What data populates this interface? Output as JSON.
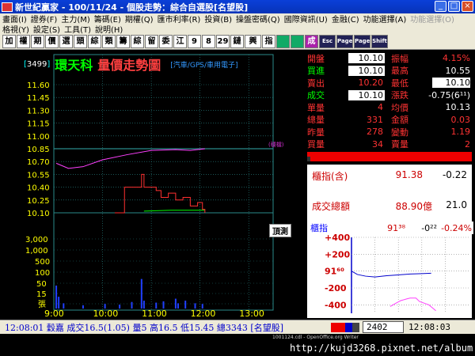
{
  "window": {
    "title": "新世紀贏家 - 100/11/24 - 個股走勢：綜合自選股[名望股]",
    "min": "_",
    "max": "□",
    "close": "×"
  },
  "menu": {
    "row1": [
      "畫面(I)",
      "證券(F)",
      "主力(M)",
      "籌碼(E)",
      "期權(Q)",
      "匯市利率(R)",
      "投資(B)",
      "操盤密碼(Q)",
      "國際資訊(U)",
      "金融(C)",
      "功能選擇(A)",
      "功能選擇(O)"
    ],
    "row2": [
      "格視(Y)",
      "設定(S)",
      "工具(T)",
      "說明(H)"
    ]
  },
  "toolbar": [
    "加",
    "權",
    "期",
    "價",
    "選",
    "頭",
    "綜",
    "類",
    "籌",
    "綜",
    "留",
    "委",
    "江",
    "9",
    "8",
    "29",
    "鏈",
    "興",
    "指",
    "",
    "",
    "成",
    "Esc",
    "Page",
    "Page",
    "Shift"
  ],
  "stock": {
    "code": "3499",
    "name": "環天科",
    "chart_title": "量價走勢圖",
    "category": "[汽車/GPS/車用電子]"
  },
  "chart_labels": {
    "day_high": "(穩檔)",
    "badge": "頂測"
  },
  "quote": {
    "rows": [
      {
        "l1": "開盤",
        "v1": "10.10",
        "b1": true,
        "l2": "振幅",
        "v2": "4.15%",
        "c2": "red"
      },
      {
        "l1": "買進",
        "v1": "10.10",
        "b1": true,
        "l2": "最高",
        "v2": "10.55",
        "c2": "white"
      },
      {
        "l1": "賣出",
        "v1": "10.20",
        "b1": false,
        "l2": "最低",
        "v2": "10.10",
        "b2": true
      },
      {
        "l1": "成交",
        "v1": "10.10",
        "b1": true,
        "l2": "漲跌",
        "v2": "-0.75(6¹¹)",
        "c2": "white"
      },
      {
        "l1": "單量",
        "v1": "4",
        "b1": false,
        "l2": "均價",
        "v2": "10.13",
        "c2": "white"
      },
      {
        "l1": "總量",
        "v1": "331",
        "b1": false,
        "l2": "金額",
        "v2": "0.03",
        "c2": "red"
      },
      {
        "l1": "昨量",
        "v1": "278",
        "b1": false,
        "l2": "變動",
        "v2": "1.19",
        "c2": "red"
      },
      {
        "l1": "買量",
        "v1": "34",
        "b1": false,
        "l2": "賣量",
        "v2": "2",
        "c2": "red"
      }
    ]
  },
  "index_panel": {
    "label1": "櫃指(含)",
    "val1": "91.38",
    "chg1": "-0.22",
    "label2": "成交總額",
    "val2": "88.90億",
    "chg2": "21.0"
  },
  "mini": {
    "label": "櫃指",
    "val": "91³⁸",
    "chg": "-0²²",
    "pct": "-0.24%",
    "y_labels": [
      "+400",
      "+200",
      "91⁶⁰",
      "-200",
      "-400"
    ]
  },
  "status": {
    "text": "12:08:01 穀嘉 成交16.5(1.05) 量5 高16.5 低15.45 總3343 [名望股]",
    "code": "2402",
    "time": "12:08:03"
  },
  "footer": {
    "small": "1001124.cdl - OpenOffice.org Writer",
    "url": "http://kujd3268.pixnet.net/album"
  },
  "colors": {
    "price_line": "#ff3030",
    "avg_line": "#ff40ff",
    "ref_line": "#00ff00",
    "volume": "#2040ff",
    "grid": "#2a8a8a"
  },
  "chart_data": {
    "type": "line",
    "price_axis": [
      "11.60",
      "11.45",
      "11.30",
      "11.15",
      "11.00",
      "10.85",
      "10.70",
      "10.55",
      "10.40",
      "10.25",
      "10.10"
    ],
    "volume_axis": [
      "3,000",
      "1,000",
      "500",
      "100",
      "50",
      "15",
      "張"
    ],
    "time_axis": [
      "9:00",
      "10:00",
      "11:00",
      "12:00",
      "13:00"
    ],
    "ylim": [
      10.1,
      11.6
    ],
    "reference_price": 10.85,
    "price_series": [
      {
        "t": 10.25,
        "p": 10.1
      },
      {
        "t": 10.4,
        "p": 10.1
      },
      {
        "t": 10.45,
        "p": 10.4
      },
      {
        "t": 10.75,
        "p": 10.4
      },
      {
        "t": 10.8,
        "p": 10.55
      },
      {
        "t": 10.85,
        "p": 10.4
      },
      {
        "t": 11.1,
        "p": 10.36
      },
      {
        "t": 11.2,
        "p": 10.28
      },
      {
        "t": 11.35,
        "p": 10.33
      },
      {
        "t": 11.5,
        "p": 10.25
      },
      {
        "t": 11.65,
        "p": 10.28
      },
      {
        "t": 11.8,
        "p": 10.18
      },
      {
        "t": 11.95,
        "p": 10.22
      },
      {
        "t": 12.05,
        "p": 10.14
      },
      {
        "t": 12.1,
        "p": 10.1
      }
    ],
    "avg_series": [
      {
        "t": 9.05,
        "p": 10.68
      },
      {
        "t": 9.3,
        "p": 10.62
      },
      {
        "t": 9.6,
        "p": 10.64
      },
      {
        "t": 10.0,
        "p": 10.72
      },
      {
        "t": 10.5,
        "p": 10.78
      },
      {
        "t": 11.0,
        "p": 10.83
      },
      {
        "t": 11.5,
        "p": 10.84
      },
      {
        "t": 11.8,
        "p": 10.83
      },
      {
        "t": 12.1,
        "p": 10.85
      }
    ],
    "green_series": [
      {
        "t": 10.85,
        "p": 10.12
      },
      {
        "t": 11.4,
        "p": 10.13
      },
      {
        "t": 11.8,
        "p": 10.13
      },
      {
        "t": 12.1,
        "p": 10.13
      }
    ],
    "volume_bars": [
      {
        "t": 9.05,
        "v": 0.35
      },
      {
        "t": 9.1,
        "v": 0.18
      },
      {
        "t": 9.2,
        "v": 0.08
      },
      {
        "t": 9.6,
        "v": 0.05
      },
      {
        "t": 10.05,
        "v": 0.07
      },
      {
        "t": 10.35,
        "v": 0.06
      },
      {
        "t": 10.6,
        "v": 0.1
      },
      {
        "t": 10.8,
        "v": 0.45
      },
      {
        "t": 10.85,
        "v": 0.12
      },
      {
        "t": 11.1,
        "v": 0.09
      },
      {
        "t": 11.25,
        "v": 0.11
      },
      {
        "t": 11.5,
        "v": 0.15
      },
      {
        "t": 11.55,
        "v": 0.08
      },
      {
        "t": 11.7,
        "v": 0.12
      },
      {
        "t": 11.9,
        "v": 0.08
      },
      {
        "t": 12.05,
        "v": 0.07
      }
    ],
    "mini_series": [
      {
        "t": 0.0,
        "v": 0
      },
      {
        "t": 0.05,
        "v": -40
      },
      {
        "t": 0.12,
        "v": -60
      },
      {
        "t": 0.2,
        "v": -70
      },
      {
        "t": 0.3,
        "v": -55
      },
      {
        "t": 0.4,
        "v": -45
      },
      {
        "t": 0.5,
        "v": -35
      },
      {
        "t": 0.6,
        "v": -30
      },
      {
        "t": 0.68,
        "v": -25
      }
    ],
    "mini_pink_series": [
      {
        "t": 0.33,
        "v": -420
      },
      {
        "t": 0.38,
        "v": -380
      },
      {
        "t": 0.42,
        "v": -350
      },
      {
        "t": 0.47,
        "v": -330
      },
      {
        "t": 0.5,
        "v": -320
      },
      {
        "t": 0.55,
        "v": -320
      },
      {
        "t": 0.58,
        "v": -360
      },
      {
        "t": 0.62,
        "v": -380
      },
      {
        "t": 0.66,
        "v": -400
      },
      {
        "t": 0.72,
        "v": -470
      }
    ]
  }
}
